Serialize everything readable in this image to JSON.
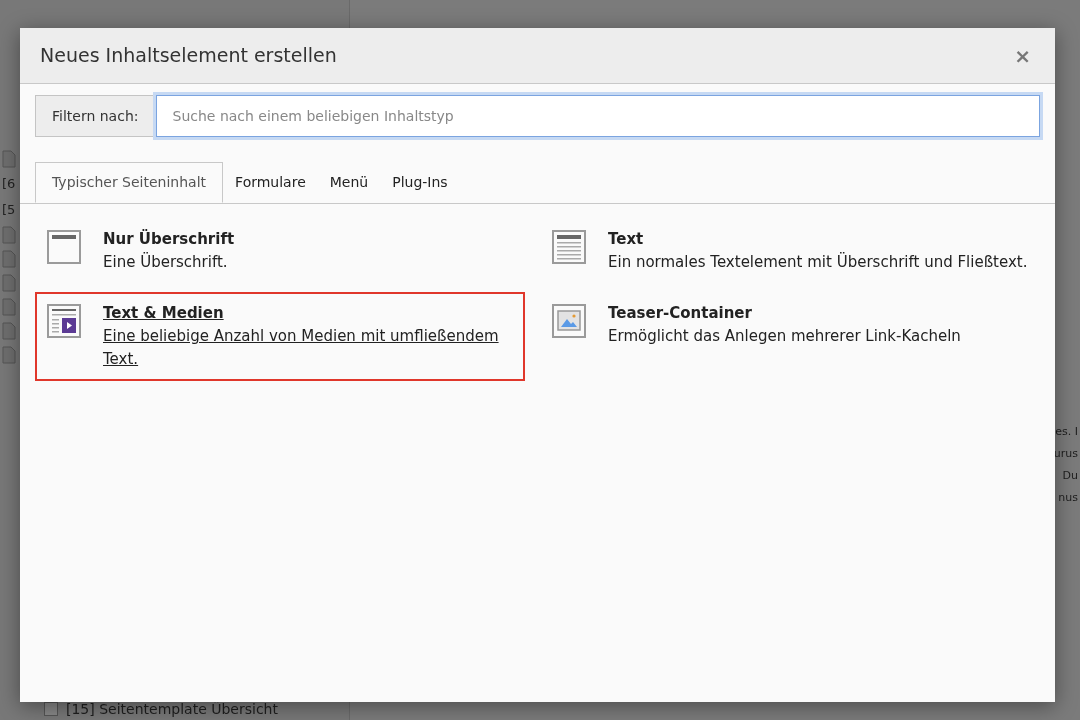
{
  "background": {
    "tree_fragments": [
      "[6",
      "[5"
    ],
    "tree_item": {
      "label": "[15] Seitentemplate Übersicht",
      "checked": false
    },
    "content_fragments": [
      "es. I",
      "urus",
      "Du",
      "nus"
    ]
  },
  "dialog": {
    "title": "Neues Inhaltselement erstellen",
    "close": "×",
    "filter": {
      "label": "Filtern nach:",
      "placeholder": "Suche nach einem beliebigen Inhaltstyp"
    },
    "tabs": [
      {
        "label": "Typischer Seiteninhalt",
        "selected": true
      },
      {
        "label": "Formulare",
        "selected": false
      },
      {
        "label": "Menü",
        "selected": false
      },
      {
        "label": "Plug-Ins",
        "selected": false
      }
    ],
    "items": [
      {
        "kind": "header",
        "title": "Nur Überschrift",
        "description": "Eine Überschrift.",
        "selected": false
      },
      {
        "kind": "text",
        "title": "Text",
        "description": "Ein normales Textelement mit Überschrift und Fließtext.",
        "selected": false
      },
      {
        "kind": "textmedia",
        "title": "Text & Medien",
        "description": "Eine beliebige Anzahl von Medien mit umfließendem Text.",
        "selected": true
      },
      {
        "kind": "teaser",
        "title": "Teaser-Container",
        "description": "Ermöglicht das Anlegen mehrerer Link-Kacheln",
        "selected": false
      }
    ]
  }
}
